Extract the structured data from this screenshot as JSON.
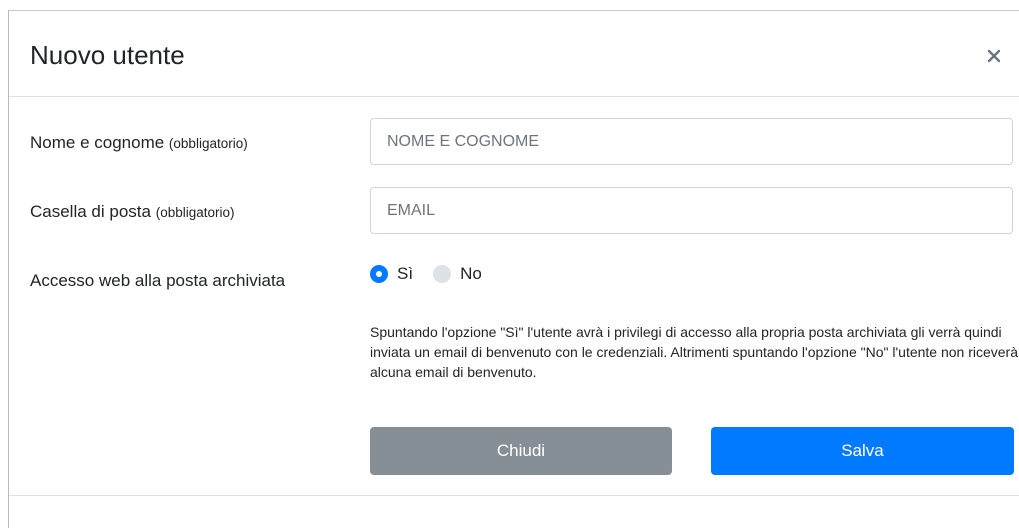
{
  "header": {
    "title": "Nuovo utente",
    "close_symbol": "×"
  },
  "form": {
    "name": {
      "label": "Nome e cognome",
      "required_note": "(obbligatorio)",
      "value": "",
      "placeholder": "NOME E COGNOME"
    },
    "email": {
      "label": "Casella di posta",
      "required_note": "(obbligatorio)",
      "value": "",
      "placeholder": "EMAIL"
    },
    "web_access": {
      "label": "Accesso web alla posta archiviata",
      "options": [
        {
          "label": "Sì",
          "checked": true
        },
        {
          "label": "No",
          "checked": false
        }
      ],
      "help_text": "Spuntando l'opzione \"Sì\" l'utente avrà i privilegi di accesso alla propria posta archiviata gli verrà quindi inviata un email di benvenuto con le credenziali. Altrimenti spuntando l'opzione \"No\" l'utente non riceverà alcuna email di benvenuto."
    }
  },
  "buttons": {
    "close_label": "Chiudi",
    "save_label": "Salva"
  },
  "icons": {
    "close": "close-icon"
  },
  "colors": {
    "primary": "#007bff",
    "secondary": "#868e96"
  }
}
